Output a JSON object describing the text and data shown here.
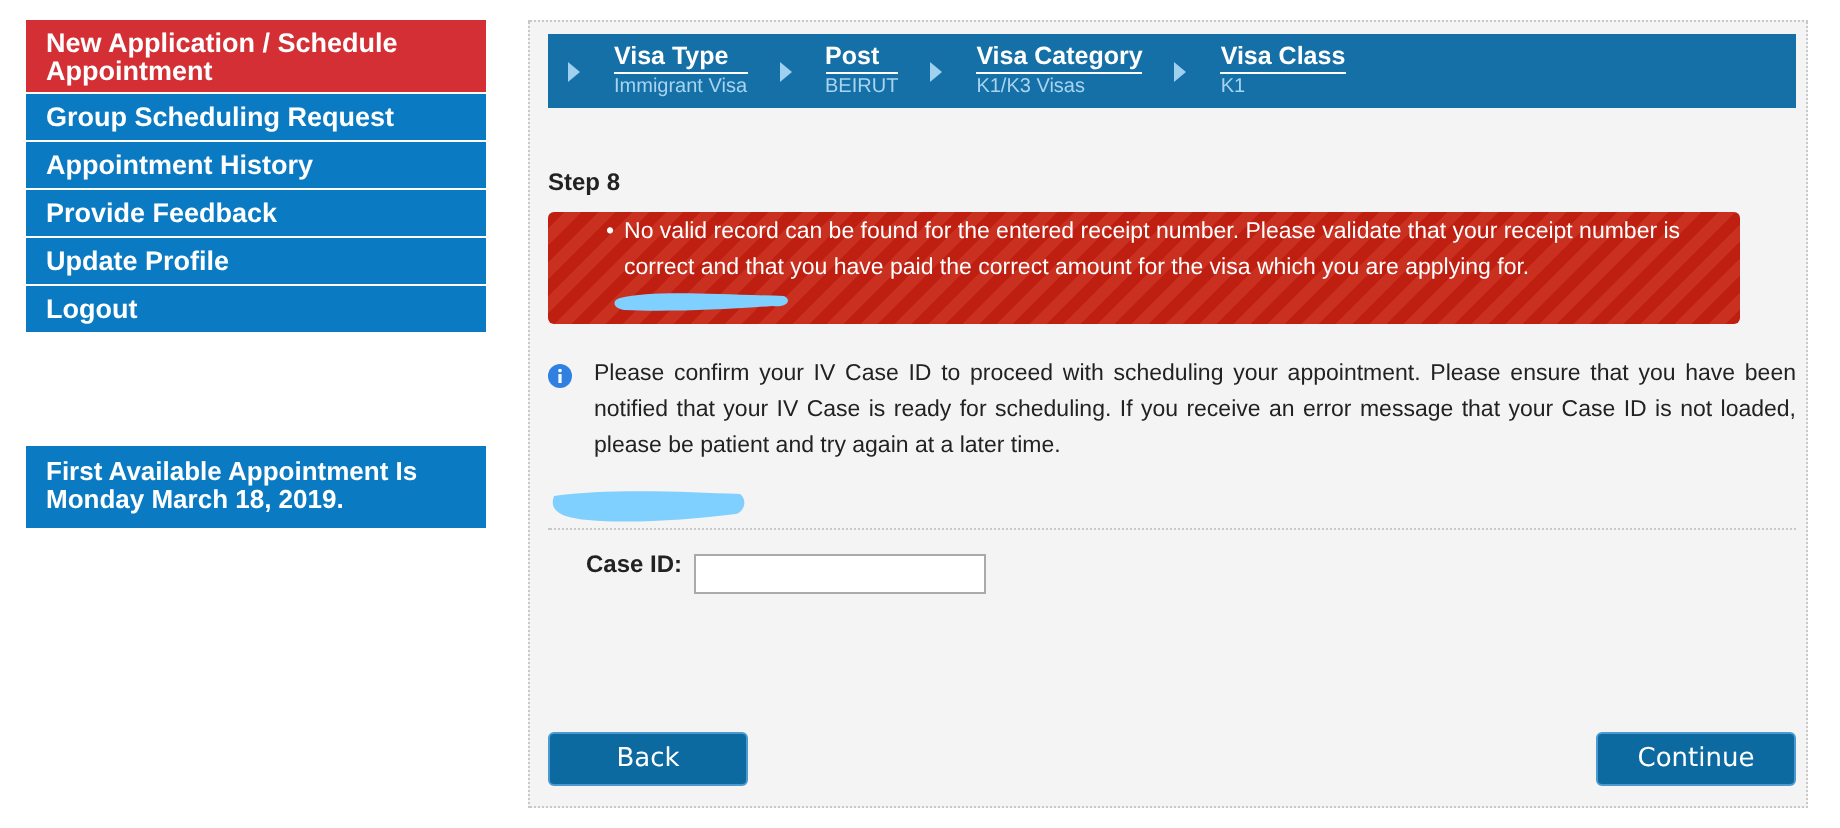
{
  "sidebar": {
    "items": [
      {
        "label": "New Application / Schedule Appointment",
        "selected": true
      },
      {
        "label": "Group Scheduling Request",
        "selected": false
      },
      {
        "label": "Appointment History",
        "selected": false
      },
      {
        "label": "Provide Feedback",
        "selected": false
      },
      {
        "label": "Update Profile",
        "selected": false
      },
      {
        "label": "Logout",
        "selected": false
      }
    ],
    "notice": "First Available Appointment Is Monday March 18, 2019."
  },
  "breadcrumb": [
    {
      "title": "Visa Type",
      "value": "Immigrant Visa"
    },
    {
      "title": "Post",
      "value": "BEIRUT"
    },
    {
      "title": "Visa Category",
      "value": "K1/K3 Visas"
    },
    {
      "title": "Visa Class",
      "value": "K1"
    }
  ],
  "step": "Step 8",
  "errors": [
    {
      "bullet": "•",
      "text": "No valid record can be found for the entered receipt number. Please validate that your receipt number is correct and that you have paid the correct amount for the visa which you are applying for."
    }
  ],
  "info": "Please confirm your IV Case ID to proceed with scheduling your appointment. Please ensure that you have been notified that your IV Case is ready for scheduling. If you receive an error message that your Case ID is not loaded, please be patient and try again at a later time.",
  "case_id": {
    "label": "Case ID:"
  },
  "buttons": {
    "back": "Back",
    "continue": "Continue"
  }
}
